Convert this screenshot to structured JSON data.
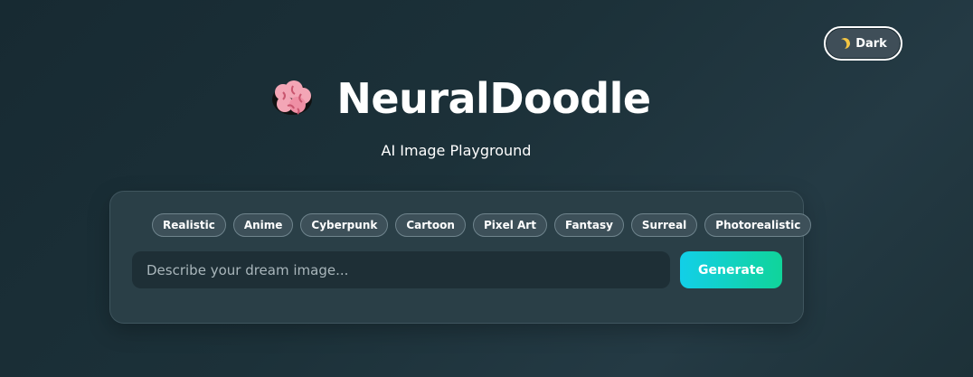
{
  "theme_toggle": {
    "icon": "moon-icon",
    "label": "Dark"
  },
  "header": {
    "icon": "brain-icon",
    "title": "NeuralDoodle",
    "subtitle": "AI Image Playground"
  },
  "styles": [
    "Realistic",
    "Anime",
    "Cyberpunk",
    "Cartoon",
    "Pixel Art",
    "Fantasy",
    "Surreal",
    "Photorealistic"
  ],
  "prompt": {
    "value": "",
    "placeholder": "Describe your dream image..."
  },
  "generate_button": {
    "label": "Generate"
  },
  "colors": {
    "accent_start": "#12cfe8",
    "accent_end": "#10d49a",
    "background": "#1c3139"
  }
}
